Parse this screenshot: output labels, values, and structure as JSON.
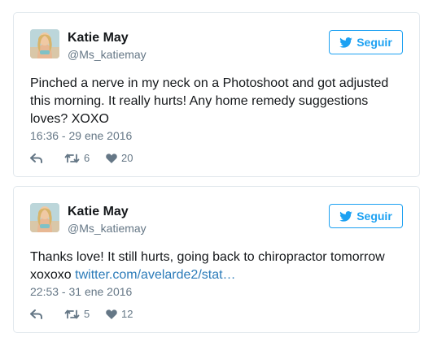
{
  "accent_color": "#1da1f2",
  "tweets": [
    {
      "author_name": "Katie May",
      "author_handle": "@Ms_katiemay",
      "follow_label": "Seguir",
      "text": "Pinched a nerve in my neck on a Photoshoot and got adjusted this morning. It really hurts! Any home remedy suggestions loves? XOXO",
      "link_text": "",
      "timestamp": "16:36 - 29 ene 2016",
      "retweets": "6",
      "likes": "20",
      "icons": [
        "reply-icon",
        "retweet-icon",
        "heart-icon",
        "twitter-bird-icon"
      ]
    },
    {
      "author_name": "Katie May",
      "author_handle": "@Ms_katiemay",
      "follow_label": "Seguir",
      "text": "Thanks love! It still hurts, going back to chiropractor tomorrow xoxoxo ",
      "link_text": "twitter.com/avelarde2/stat…",
      "timestamp": "22:53 - 31 ene 2016",
      "retweets": "5",
      "likes": "12",
      "icons": [
        "reply-icon",
        "retweet-icon",
        "heart-icon",
        "twitter-bird-icon"
      ]
    }
  ]
}
